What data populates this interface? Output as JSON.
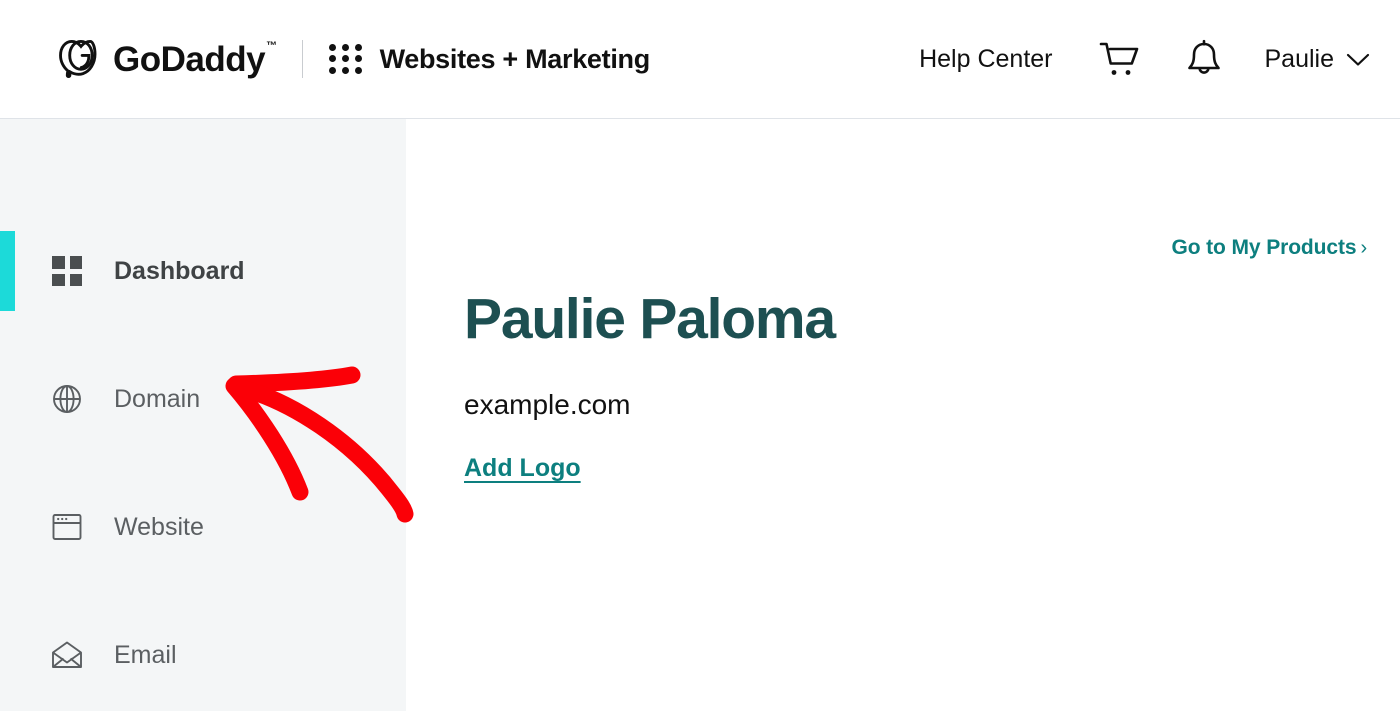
{
  "header": {
    "brand_name": "GoDaddy",
    "brand_tm": "™",
    "brand_logo_icon": "godaddy-heart-logo",
    "divider": "|",
    "app_launcher_icon": "app-grid-icon",
    "product_title": "Websites + Marketing",
    "help_center_label": "Help Center",
    "cart_icon": "shopping-cart-icon",
    "notifications_icon": "bell-icon",
    "account_name": "Paulie",
    "account_chevron_icon": "chevron-down-icon"
  },
  "sidebar": {
    "items": [
      {
        "label": "Dashboard",
        "icon": "grid-icon",
        "active": true
      },
      {
        "label": "Domain",
        "icon": "globe-icon",
        "active": false
      },
      {
        "label": "Website",
        "icon": "browser-icon",
        "active": false
      },
      {
        "label": "Email",
        "icon": "envelope-icon",
        "active": false
      }
    ]
  },
  "main": {
    "products_link_label": "Go to My Products",
    "products_link_caret": "›",
    "page_title": "Paulie Paloma",
    "domain": "example.com",
    "add_logo_label": "Add Logo"
  },
  "annotation": {
    "type": "hand-drawn-arrow",
    "color": "#fb0007",
    "points_to": "Domain",
    "description": "Red hand-drawn arrow pointing left at the Domain sidebar item"
  },
  "colors": {
    "accent_teal": "#0d7f7f",
    "active_bar_cyan": "#1cdad9",
    "title_teal": "#1d4f51",
    "sidebar_bg": "#f4f6f7",
    "nav_label_gray": "#5b5f62",
    "annotation_red": "#fb0007"
  }
}
